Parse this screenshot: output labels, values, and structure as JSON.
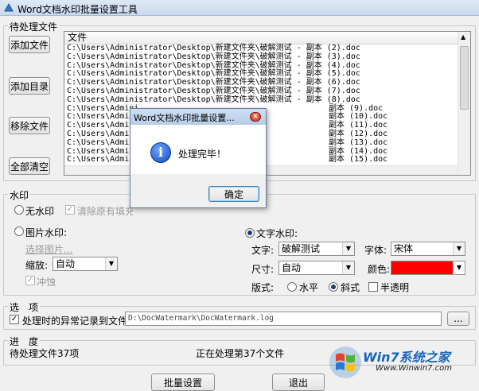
{
  "window": {
    "title": "Word文档水印批量设置工具"
  },
  "files_group": {
    "label": "待处理文件",
    "buttons": {
      "add_file": "添加文件",
      "add_dir": "添加目录",
      "remove": "移除文件",
      "clear": "全部清空"
    },
    "list": {
      "column": "文件",
      "rows": [
        "C:\\Users\\Administrator\\Desktop\\新建文件夹\\破解测试 - 副本 (2).doc",
        "C:\\Users\\Administrator\\Desktop\\新建文件夹\\破解测试 - 副本 (3).doc",
        "C:\\Users\\Administrator\\Desktop\\新建文件夹\\破解测试 - 副本 (4).doc",
        "C:\\Users\\Administrator\\Desktop\\新建文件夹\\破解测试 - 副本 (5).doc",
        "C:\\Users\\Administrator\\Desktop\\新建文件夹\\破解测试 - 副本 (6).doc",
        "C:\\Users\\Administrator\\Desktop\\新建文件夹\\破解测试 - 副本 (7).doc",
        "C:\\Users\\Administrator\\Desktop\\新建文件夹\\破解测试 - 副本 (8).doc",
        "C:\\Users\\Admini",
        "C:\\Users\\Admini",
        "C:\\Users\\Admini",
        "C:\\Users\\Admini",
        "C:\\Users\\Admini",
        "C:\\Users\\Admini",
        "C:\\Users\\Admini"
      ],
      "rows_right": [
        "",
        "",
        "",
        "",
        "",
        "",
        "",
        "副本 (9).doc",
        "副本 (10).doc",
        "副本 (11).doc",
        "副本 (12).doc",
        "副本 (13).doc",
        "副本 (14).doc",
        "副本 (15).doc"
      ]
    }
  },
  "watermark_group": {
    "label": "水印",
    "no_watermark": "无水印",
    "clear_existing": "清除原有填充水印",
    "image_watermark": "图片水印:",
    "choose_image": "选择图片...",
    "scale_label": "缩放:",
    "scale_value": "自动",
    "washout": "冲蚀",
    "text_watermark": "文字水印:",
    "text_label": "文字:",
    "text_value": "破解测试",
    "font_label": "字体:",
    "font_value": "宋体",
    "size_label": "尺寸:",
    "size_value": "自动",
    "color_label": "颜色:",
    "color_value": "#ff0000",
    "layout_label": "版式:",
    "layout_horizontal": "水平",
    "layout_diagonal": "斜式",
    "semi_transparent": "半透明"
  },
  "options_group": {
    "label": "选　项",
    "log_errors": "处理时的异常记录到文件:",
    "log_path": "D:\\DocWatermark\\DocWatermark.log",
    "browse": "..."
  },
  "progress_group": {
    "label": "进　度",
    "pending": "待处理文件37项",
    "status": "正在处理第37个文件"
  },
  "bottom_buttons": {
    "batch": "批量设置",
    "exit": "退出"
  },
  "dialog": {
    "title": "Word文档水印批量设置...",
    "message": "处理完毕！",
    "ok": "确定"
  },
  "logo": {
    "brand": "Win7系统之家",
    "url": "Www.Winwin7.com"
  }
}
